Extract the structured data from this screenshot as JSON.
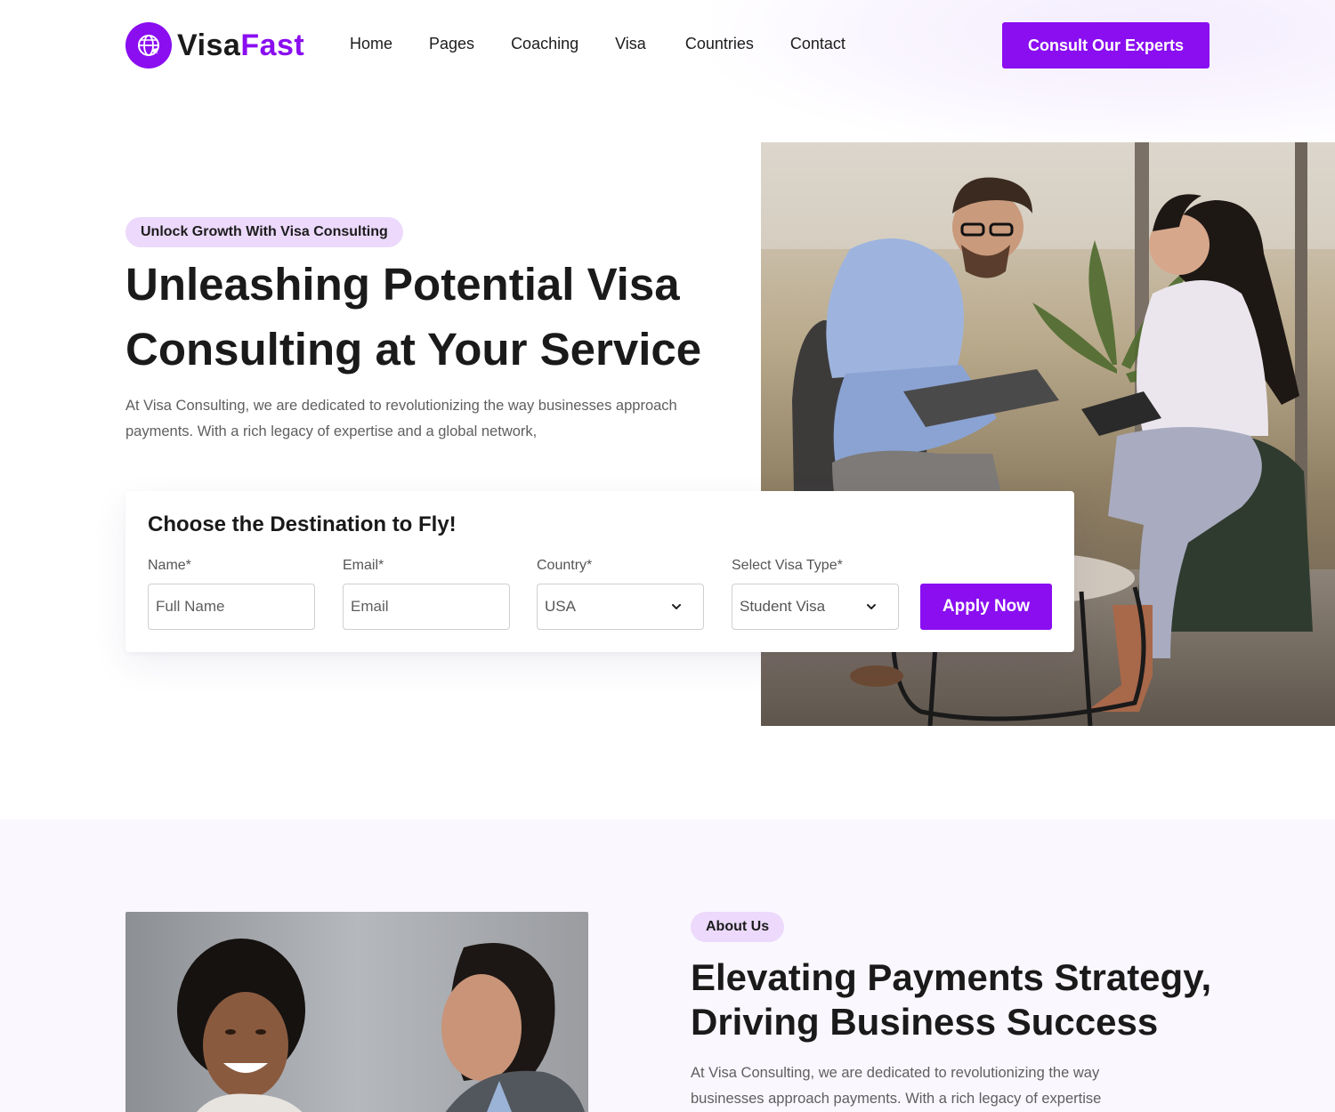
{
  "brand": {
    "name_part1": "Visa",
    "name_part2": "Fast",
    "accent_color": "#8a0ef0",
    "logo_icon": "globe-plane-icon"
  },
  "nav": {
    "items": [
      "Home",
      "Pages",
      "Coaching",
      "Visa",
      "Countries",
      "Contact"
    ],
    "cta_label": "Consult Our Experts"
  },
  "hero": {
    "tag": "Unlock Growth With Visa Consulting",
    "title": "Unleashing Potential Visa Consulting at Your Service",
    "description": "At Visa Consulting, we are dedicated to revolutionizing the way businesses approach payments. With a rich legacy of expertise and a global network,"
  },
  "form": {
    "title": "Choose the Destination to Fly!",
    "name_label": "Name*",
    "name_placeholder": "Full Name",
    "email_label": "Email*",
    "email_placeholder": "Email",
    "country_label": "Country*",
    "country_value": "USA",
    "visa_label": "Select Visa Type*",
    "visa_value": "Student Visa",
    "submit_label": "Apply Now"
  },
  "about": {
    "tag": "About Us",
    "title": "Elevating Payments Strategy, Driving Business Success",
    "description": "At Visa Consulting, we are dedicated to revolutionizing the way businesses approach payments. With a rich legacy of expertise"
  }
}
